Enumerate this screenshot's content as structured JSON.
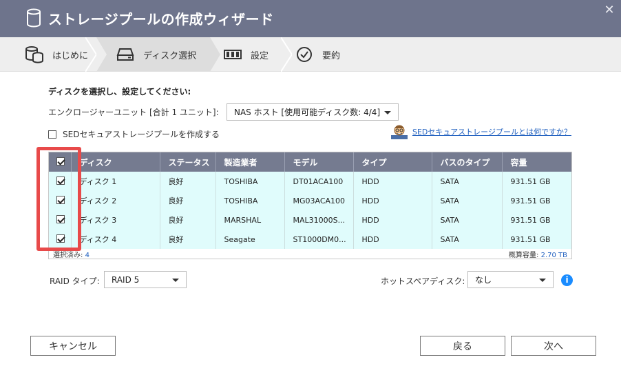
{
  "window": {
    "title": "ストレージプールの作成ウィザード",
    "close_symbol": "✕"
  },
  "steps": [
    {
      "label": "はじめに",
      "icon": "database-icon"
    },
    {
      "label": "ディスク選択",
      "icon": "hard-drive-icon",
      "active": true
    },
    {
      "label": "設定",
      "icon": "raid-settings-icon"
    },
    {
      "label": "要約",
      "icon": "check-circle-icon"
    }
  ],
  "form": {
    "heading": "ディスクを選択し、設定してください:",
    "enclosure_label": "エンクロージャーユニット [合計 1 ユニット]:",
    "enclosure_value": "NAS ホスト [使用可能ディスク数: 4/4]",
    "sed_checkbox_label": "SEDセキュアストレージプールを作成する",
    "sed_link": "SEDセキュアストレージプールとは何ですか？"
  },
  "table": {
    "columns": [
      "ディスク",
      "ステータス",
      "製造業者",
      "モデル",
      "タイプ",
      "バスのタイプ",
      "容量"
    ],
    "rows": [
      {
        "disk": "ディスク 1",
        "status": "良好",
        "vendor": "TOSHIBA",
        "model": "DT01ACA100",
        "type": "HDD",
        "bus": "SATA",
        "capacity": "931.51 GB",
        "checked": true
      },
      {
        "disk": "ディスク 2",
        "status": "良好",
        "vendor": "TOSHIBA",
        "model": "MG03ACA100",
        "type": "HDD",
        "bus": "SATA",
        "capacity": "931.51 GB",
        "checked": true
      },
      {
        "disk": "ディスク 3",
        "status": "良好",
        "vendor": "MARSHAL",
        "model": "MAL31000S...",
        "type": "HDD",
        "bus": "SATA",
        "capacity": "931.51 GB",
        "checked": true
      },
      {
        "disk": "ディスク 4",
        "status": "良好",
        "vendor": "Seagate",
        "model": "ST1000DM0...",
        "type": "HDD",
        "bus": "SATA",
        "capacity": "931.51 GB",
        "checked": true
      }
    ],
    "selected_label": "選択済み:",
    "selected_count": "4",
    "capacity_label": "概算容量:",
    "capacity_value": "2.70 TB"
  },
  "raid": {
    "label": "RAID タイプ:",
    "value": "RAID 5"
  },
  "hotspare": {
    "label": "ホットスペアディスク:",
    "value": "なし"
  },
  "buttons": {
    "cancel": "キャンセル",
    "back": "戻る",
    "next": "次へ"
  },
  "colors": {
    "titlebar": "#6e748c",
    "row_highlight": "#e0fcfc",
    "callout": "#e84a4a",
    "link": "#1f5fbf",
    "info": "#1a8cff"
  }
}
